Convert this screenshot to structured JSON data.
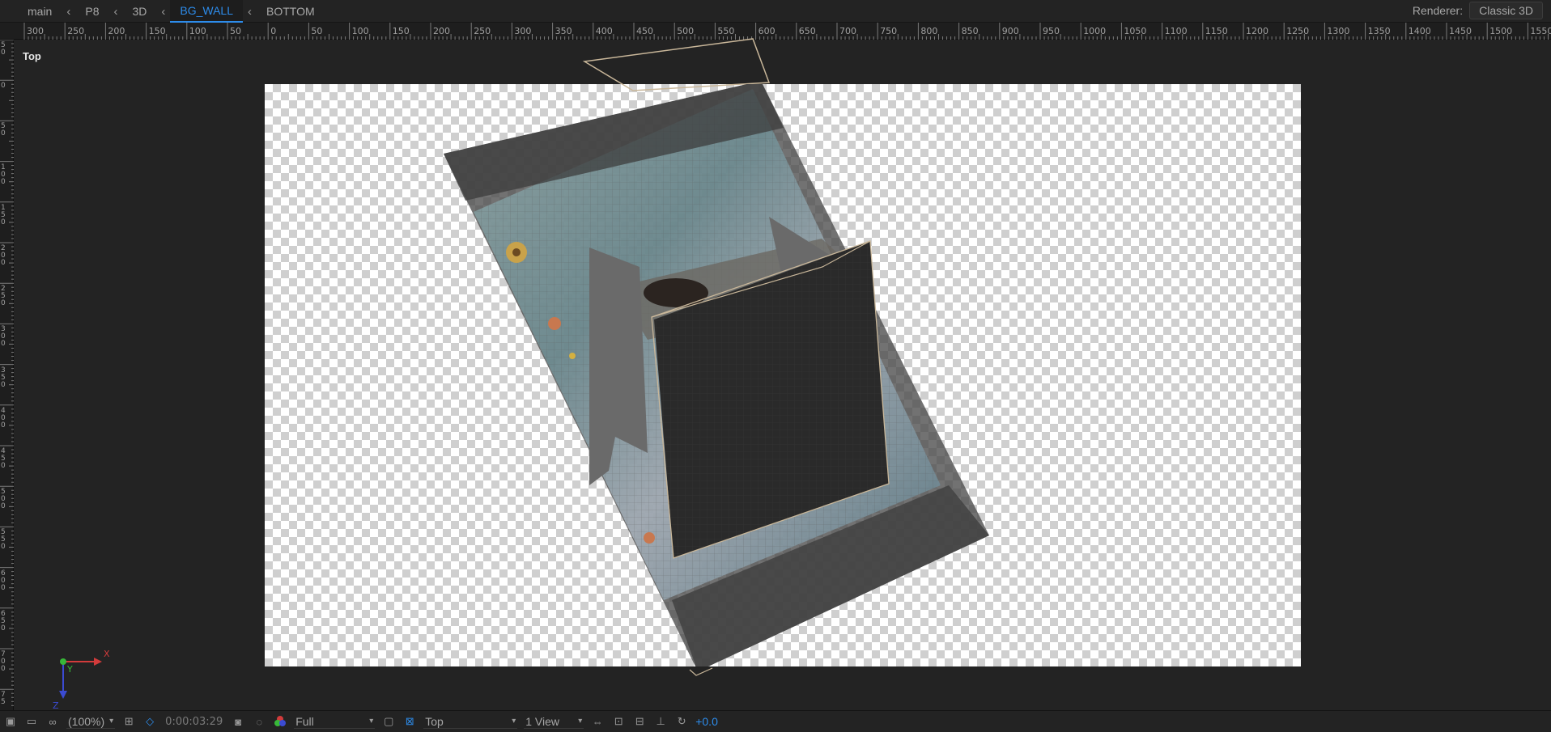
{
  "breadcrumb": {
    "items": [
      "main",
      "P8",
      "3D",
      "BG_WALL",
      "BOTTOM"
    ],
    "active_index": 3,
    "separator": "‹"
  },
  "renderer": {
    "label": "Renderer:",
    "value": "Classic 3D"
  },
  "ruler": {
    "h_labels": [
      "300",
      "250",
      "200",
      "150",
      "100",
      "50",
      "0",
      "50",
      "100",
      "150",
      "200",
      "250",
      "300",
      "350",
      "400",
      "450",
      "500",
      "550",
      "600",
      "650",
      "700",
      "750",
      "800",
      "850",
      "900",
      "950",
      "1000",
      "1050",
      "1100",
      "1150",
      "1200",
      "1250",
      "1300",
      "1350",
      "1400",
      "1450",
      "1500",
      "1550"
    ],
    "v_labels": [
      "5\n0",
      "0",
      "5\n0",
      "1\n0\n0",
      "1\n5\n0",
      "2\n0\n0",
      "2\n5\n0",
      "3\n0\n0",
      "3\n5\n0",
      "4\n0\n0",
      "4\n5\n0",
      "5\n0\n0",
      "5\n5\n0",
      "6\n0\n0",
      "6\n5\n0",
      "7\n0\n0",
      "7\n5"
    ]
  },
  "viewer": {
    "view_name": "Top"
  },
  "gizmo": {
    "x_label": "X",
    "y_label": "Y",
    "z_label": "Z"
  },
  "toolbar": {
    "zoom": "(100%)",
    "timecode": "0:00:03:29",
    "resolution": "Full",
    "view": "Top",
    "layout": "1 View",
    "exposure": "+0.0"
  },
  "colors": {
    "accent": "#2d8ceb",
    "background": "#232323",
    "transparency_check": "#cfcfcf"
  }
}
